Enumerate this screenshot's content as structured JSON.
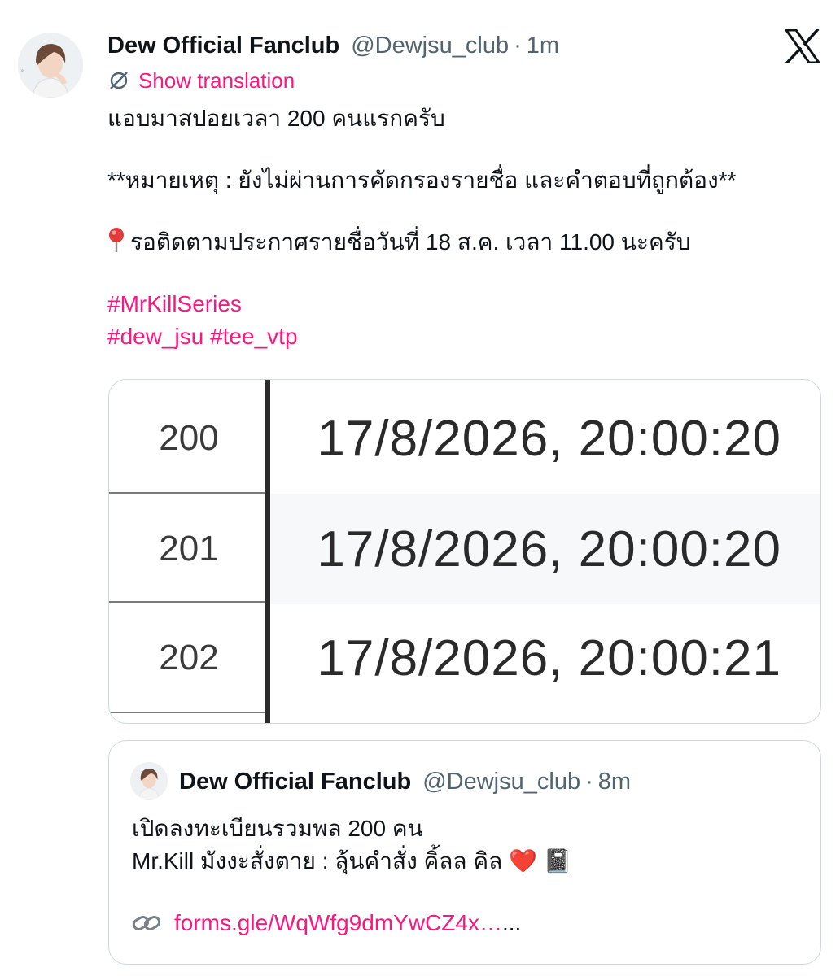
{
  "tweet": {
    "author_name": "Dew Official Fanclub",
    "handle": "@Dewjsu_club",
    "separator": "·",
    "time": "1m",
    "translate_label": "Show translation",
    "line1": "แอบมาสปอยเวลา 200 คนแรกครับ",
    "line2": "**หมายเหตุ : ยังไม่ผ่านการคัดกรองรายชื่อ และคำตอบที่ถูกต้อง**",
    "line3": "รอติดตามประกาศรายชื่อวันที่ 18 ส.ค. เวลา 11.00 นะครับ",
    "hashtags": [
      "#MrKillSeries",
      "#dew_jsu",
      "#tee_vtp"
    ]
  },
  "image": {
    "rows": [
      {
        "index": "200",
        "timestamp": "17/8/2026, 20:00:20"
      },
      {
        "index": "201",
        "timestamp": "17/8/2026, 20:00:20"
      },
      {
        "index": "202",
        "timestamp": "17/8/2026, 20:00:21"
      }
    ]
  },
  "quote": {
    "author_name": "Dew Official Fanclub",
    "handle": "@Dewjsu_club",
    "separator": "·",
    "time": "8m",
    "line1": "เปิดลงทะเบียนรวมพล 200 คน",
    "line2": "Mr.Kill มังงะสั่งตาย : ลุ้นคำสั่ง คิ้ลล คิล ❤️ 📓",
    "link": "forms.gle/WqWfg9dmYwCZ4x…",
    "link_suffix": "..."
  },
  "colors": {
    "accent": "#f91880",
    "text": "#0f1419",
    "secondary": "#536471",
    "border": "#cfd9de"
  },
  "icons": {
    "logo": "x-logo-icon",
    "translate": "translate-icon",
    "pin": "pushpin-icon",
    "link": "link-icon"
  }
}
